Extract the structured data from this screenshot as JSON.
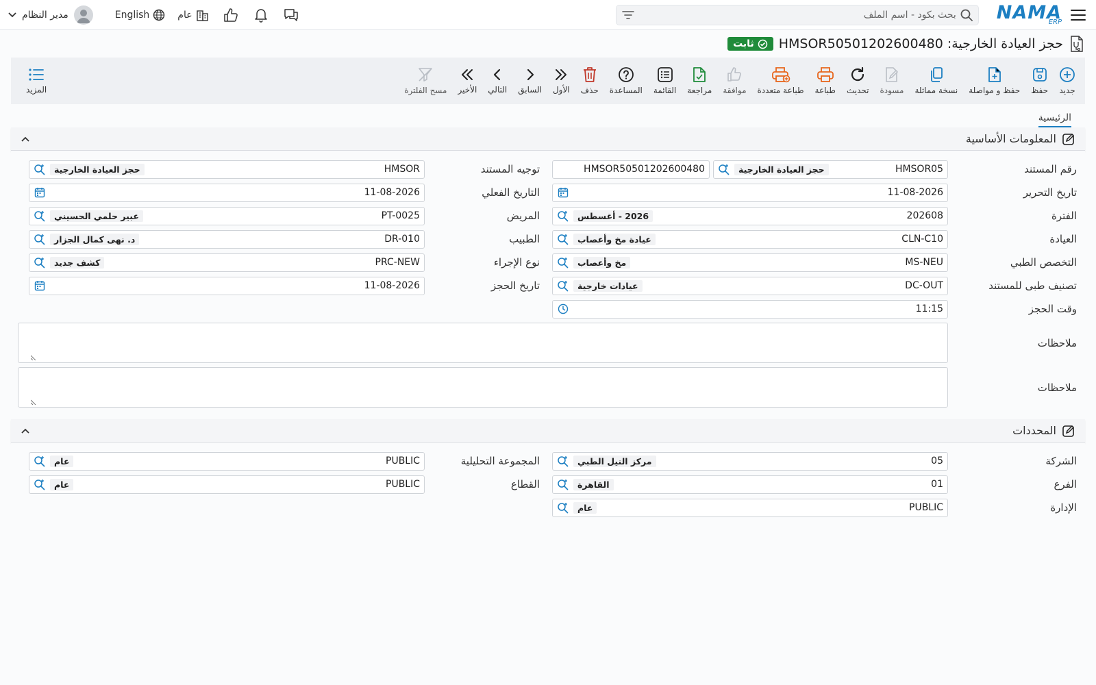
{
  "topbar": {
    "logo_main": "NAMA",
    "logo_sub": "ERP",
    "search_placeholder": "بحث بكود - اسم الملف",
    "user_name": "مدير النظام",
    "language": "English",
    "company_scope": "عام"
  },
  "page": {
    "title": "حجز العيادة الخارجية: HMSOR50501202600480",
    "status_badge": "ثابت"
  },
  "toolbar": [
    {
      "key": "new",
      "label": "جديد",
      "icon": "plus-circle-icon",
      "color": "#1c7fc2"
    },
    {
      "key": "save",
      "label": "حفظ",
      "icon": "save-icon",
      "color": "#1c7fc2"
    },
    {
      "key": "save-continue",
      "label": "حفظ و مواصلة",
      "icon": "file-plus-icon",
      "color": "#1c7fc2"
    },
    {
      "key": "duplicate",
      "label": "نسخة مماثلة",
      "icon": "copy-icon",
      "color": "#1c7fc2"
    },
    {
      "key": "draft",
      "label": "مسودة",
      "icon": "edit-doc-icon",
      "color": "#b9bec5"
    },
    {
      "key": "refresh",
      "label": "تحديث",
      "icon": "refresh-icon",
      "color": "#222"
    },
    {
      "key": "print",
      "label": "طباعة",
      "icon": "printer-icon",
      "color": "#e8661c"
    },
    {
      "key": "multi-print",
      "label": "طباعة متعددة",
      "icon": "multi-printer-icon",
      "color": "#e8661c"
    },
    {
      "key": "approve",
      "label": "موافقة",
      "icon": "thumb-up-icon",
      "color": "#b9bec5"
    },
    {
      "key": "review",
      "label": "مراجعة",
      "icon": "file-check-icon",
      "color": "#1f8b3a"
    },
    {
      "key": "list",
      "label": "القائمة",
      "icon": "list-icon",
      "color": "#222"
    },
    {
      "key": "help",
      "label": "المساعدة",
      "icon": "help-icon",
      "color": "#222"
    },
    {
      "key": "delete",
      "label": "حذف",
      "icon": "trash-icon",
      "color": "#c0392b"
    },
    {
      "key": "first",
      "label": "الأول",
      "icon": "double-chevron-right-icon",
      "color": "#222"
    },
    {
      "key": "previous",
      "label": "السابق",
      "icon": "chevron-right-icon",
      "color": "#222"
    },
    {
      "key": "next",
      "label": "التالي",
      "icon": "chevron-left-icon",
      "color": "#222"
    },
    {
      "key": "last",
      "label": "الأخير",
      "icon": "double-chevron-left-icon",
      "color": "#222"
    },
    {
      "key": "clear-filter",
      "label": "مسح الفلترة",
      "icon": "filter-off-icon",
      "color": "#b9bec5"
    }
  ],
  "toolbar_more": {
    "label": "المزيد",
    "icon": "list-bullets-icon",
    "color": "#1c7fc2"
  },
  "tabs": {
    "main": "الرئيسية"
  },
  "basic_info": {
    "title": "المعلومات الأساسية",
    "doc_number": {
      "label": "رقم المستند",
      "code": "HMSOR05",
      "desc": "حجز العيادة الخارجية",
      "number": "HMSOR50501202600480"
    },
    "doc_direction": {
      "label": "توجيه المستند",
      "code": "HMSOR",
      "desc": "حجز العيادة الخارجية"
    },
    "edit_date": {
      "label": "تاريخ التحرير",
      "value": "11-08-2026"
    },
    "actual_date": {
      "label": "التاريخ الفعلي",
      "value": "11-08-2026"
    },
    "period": {
      "label": "الفترة",
      "code": "202608",
      "desc": "2026 - أغسطس"
    },
    "patient": {
      "label": "المريض",
      "code": "PT-0025",
      "desc": "عبير حلمي الحسيني"
    },
    "clinic": {
      "label": "العيادة",
      "code": "CLN-C10",
      "desc": "عيادة مخ وأعصاب"
    },
    "doctor": {
      "label": "الطبيب",
      "code": "DR-010",
      "desc": "د. نهى كمال الجزار"
    },
    "specialty": {
      "label": "التخصص الطبي",
      "code": "MS-NEU",
      "desc": "مخ وأعصاب"
    },
    "procedure_type": {
      "label": "نوع الإجراء",
      "code": "PRC-NEW",
      "desc": "كشف جديد"
    },
    "medical_class": {
      "label": "تصنيف طبى للمستند",
      "code": "DC-OUT",
      "desc": "عيادات خارجية"
    },
    "booking_date": {
      "label": "تاريخ الحجز",
      "value": "11-08-2026"
    },
    "booking_time": {
      "label": "وقت الحجز",
      "value": "11:15"
    },
    "notes1": {
      "label": "ملاحظات"
    },
    "notes2": {
      "label": "ملاحظات"
    }
  },
  "determinants": {
    "title": "المحددات",
    "company": {
      "label": "الشركة",
      "code": "05",
      "desc": "مركز النيل الطبي"
    },
    "analysis_group": {
      "label": "المجموعة التحليلية",
      "code": "PUBLIC",
      "desc": "عام"
    },
    "branch": {
      "label": "الفرع",
      "code": "01",
      "desc": "القاهرة"
    },
    "sector": {
      "label": "القطاع",
      "code": "PUBLIC",
      "desc": "عام"
    },
    "department": {
      "label": "الإدارة",
      "code": "PUBLIC",
      "desc": "عام"
    }
  },
  "colors": {
    "accent": "#1c7fc2",
    "success": "#1f8b3a",
    "danger": "#c0392b",
    "print": "#e8661c"
  }
}
